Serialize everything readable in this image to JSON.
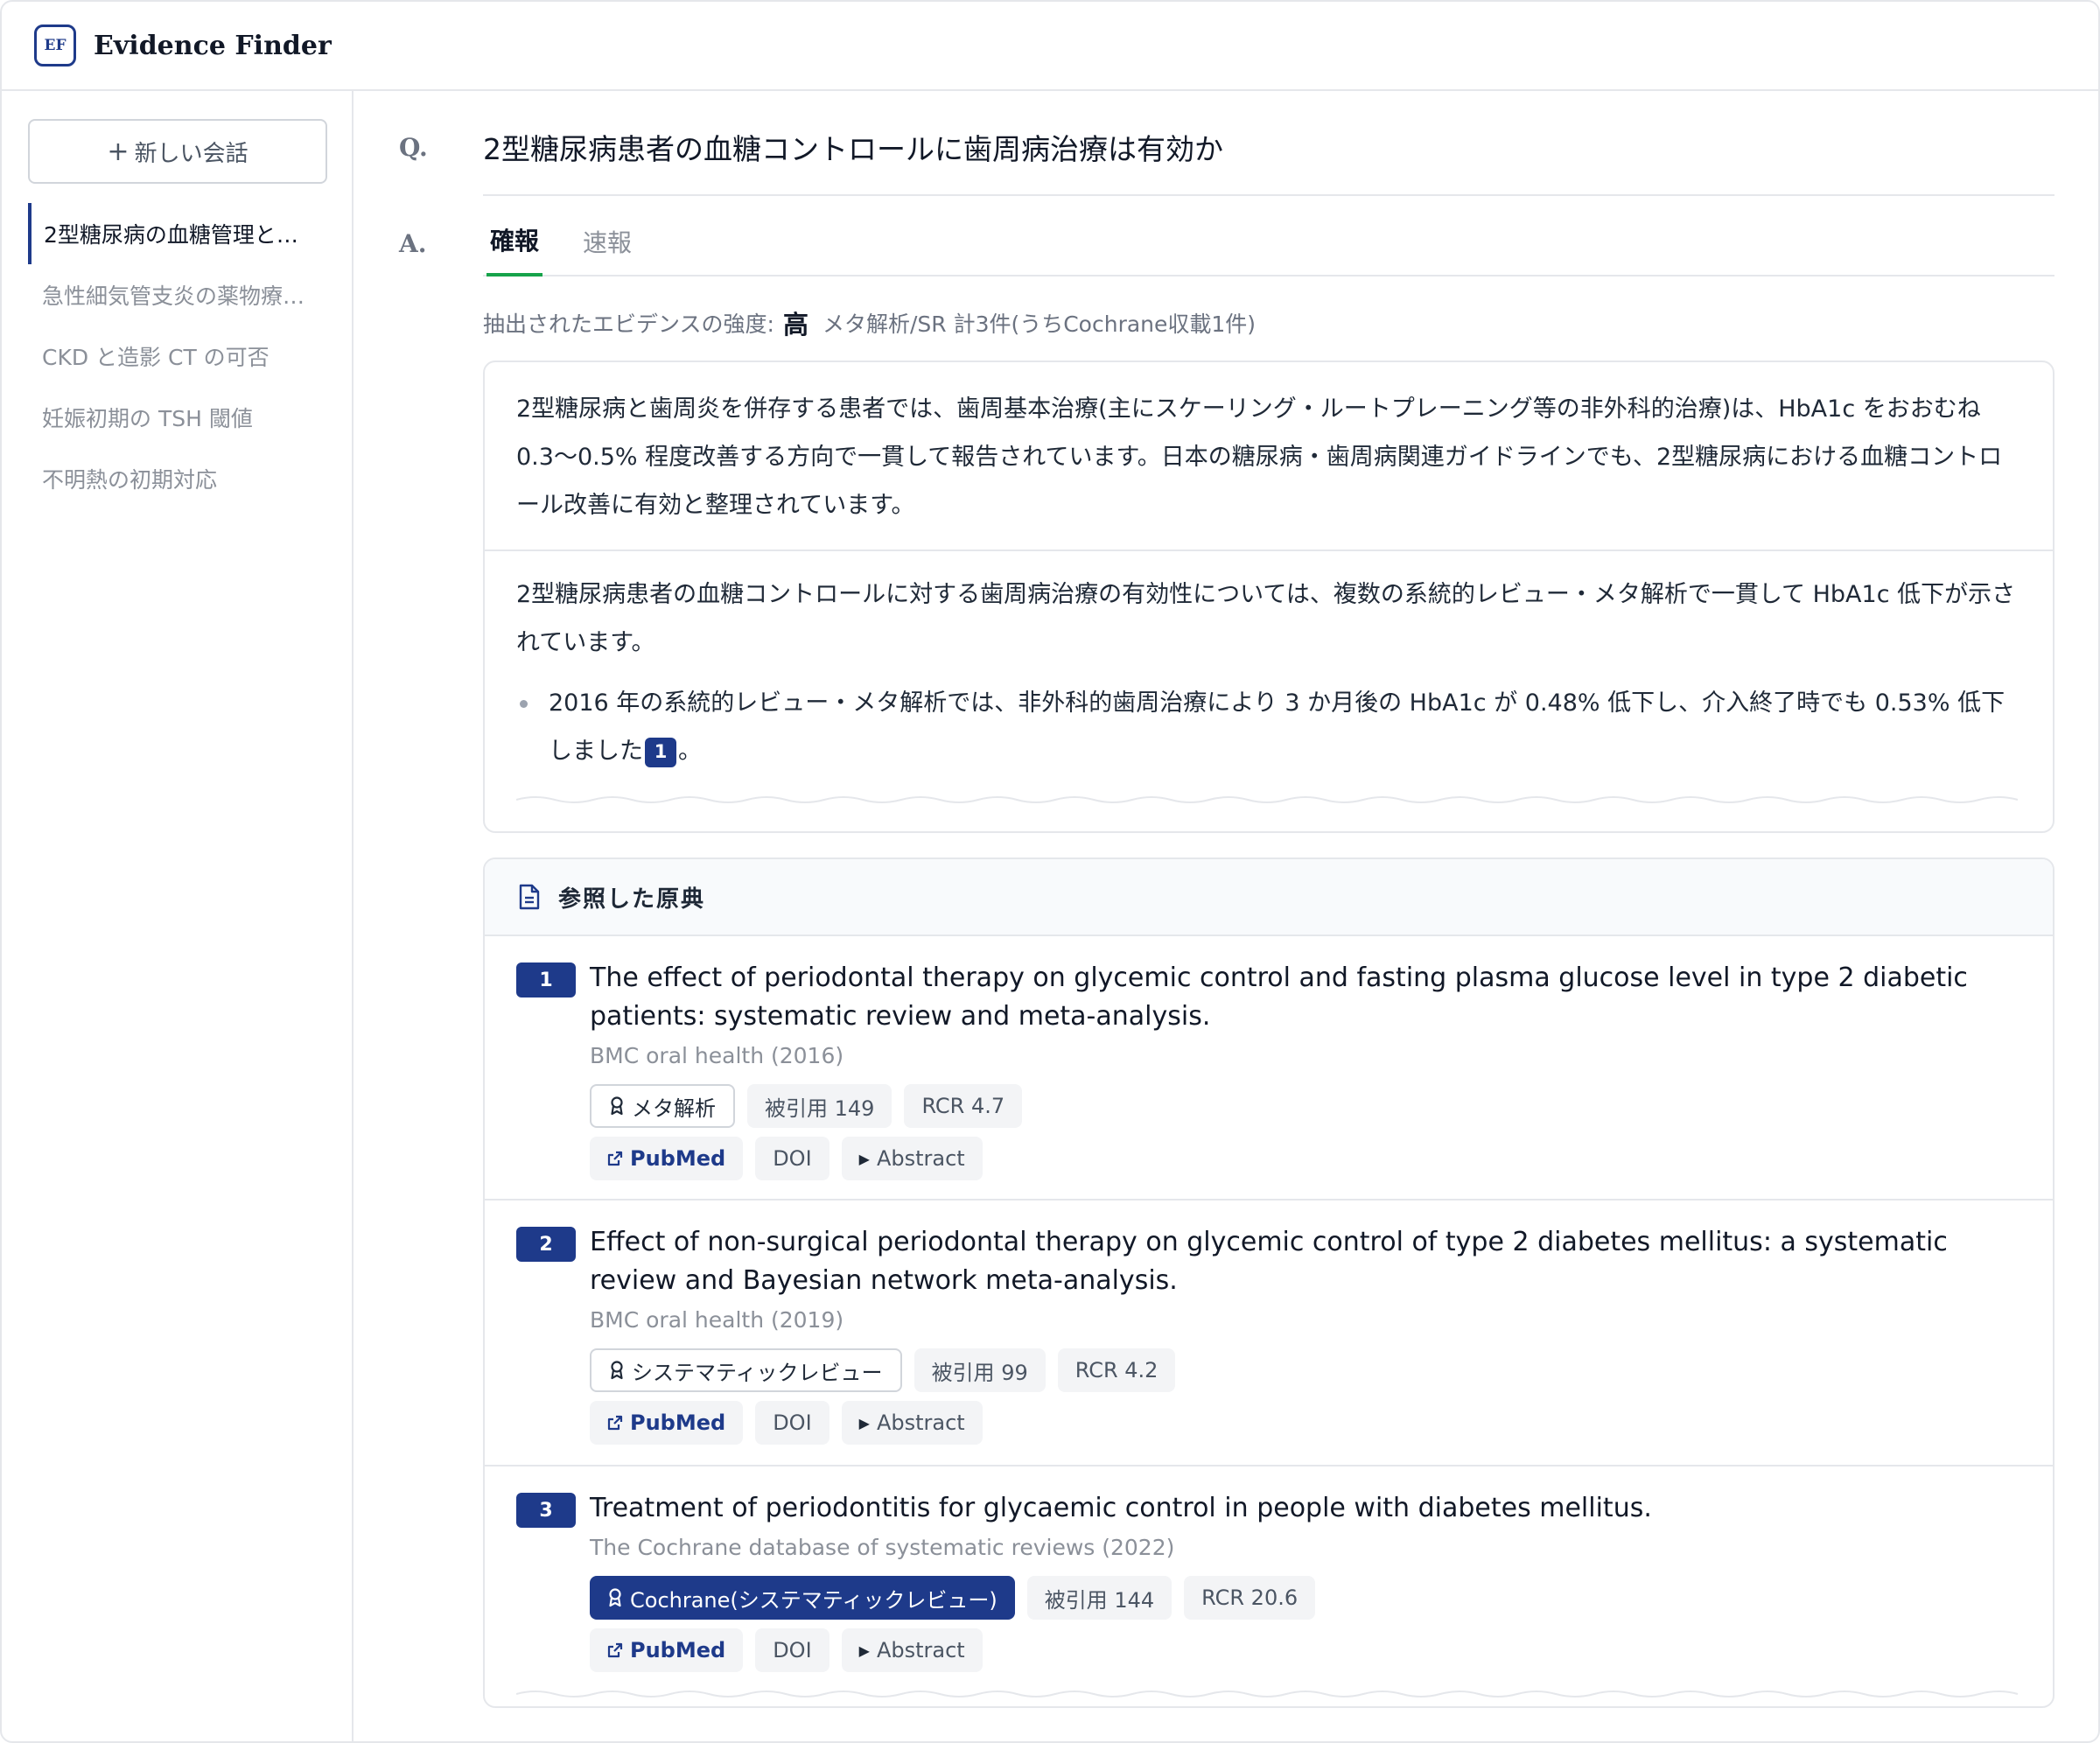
{
  "app": {
    "logo": "EF",
    "title": "Evidence Finder"
  },
  "sidebar": {
    "new_chat": "新しい会話",
    "items": [
      {
        "label": "2型糖尿病の血糖管理と…"
      },
      {
        "label": "急性細気管支炎の薬物療…"
      },
      {
        "label": "CKD と造影 CT の可否"
      },
      {
        "label": "妊娠初期の TSH 閾値"
      },
      {
        "label": "不明熱の初期対応"
      }
    ]
  },
  "main": {
    "q_label": "Q.",
    "question": "2型糖尿病患者の血糖コントロールに歯周病治療は有効か",
    "a_label": "A.",
    "tabs": [
      {
        "label": "確報"
      },
      {
        "label": "速報"
      }
    ],
    "strength": {
      "label": "抽出されたエビデンスの強度:",
      "level": "高",
      "detail": "メタ解析/SR 計3件(うちCochrane収載1件)"
    },
    "summary": "2型糖尿病と歯周炎を併存する患者では、歯周基本治療(主にスケーリング・ルートプレーニング等の非外科的治療)は、HbA1c をおおむね 0.3〜0.5% 程度改善する方向で一貫して報告されています。日本の糖尿病・歯周病関連ガイドラインでも、2型糖尿病における血糖コントロール改善に有効と整理されています。",
    "detail_intro": "2型糖尿病患者の血糖コントロールに対する歯周病治療の有効性については、複数の系統的レビュー・メタ解析で一貫して HbA1c 低下が示されています。",
    "bullet": {
      "text": "2016 年の系統的レビュー・メタ解析では、非外科的歯周治療により 3 か月後の HbA1c が 0.48% 低下し、介入終了時でも 0.53% 低下しました",
      "cite": "1",
      "end": "。"
    }
  },
  "sources": {
    "title": "参照した原典",
    "refs": [
      {
        "num": "1",
        "title": "The effect of periodontal therapy on glycemic control and fasting plasma glucose level in type 2 diabetic patients: systematic review and meta-analysis.",
        "journal": "BMC oral health (2016)",
        "type": "メタ解析",
        "citations": "被引用 149",
        "rcr": "RCR 4.7",
        "pubmed": "PubMed",
        "doi": "DOI",
        "abstract": "Abstract"
      },
      {
        "num": "2",
        "title": "Effect of non-surgical periodontal therapy on glycemic control of type 2 diabetes mellitus: a systematic review and Bayesian network meta-analysis.",
        "journal": "BMC oral health (2019)",
        "type": "システマティックレビュー",
        "citations": "被引用 99",
        "rcr": "RCR 4.2",
        "pubmed": "PubMed",
        "doi": "DOI",
        "abstract": "Abstract"
      },
      {
        "num": "3",
        "title": "Treatment of periodontitis for glycaemic control in people with diabetes mellitus.",
        "journal": "The Cochrane database of systematic reviews (2022)",
        "type": "Cochrane(システマティックレビュー)",
        "citations": "被引用 144",
        "rcr": "RCR 20.6",
        "pubmed": "PubMed",
        "doi": "DOI",
        "abstract": "Abstract"
      }
    ]
  },
  "colors": {
    "accent": "#1e3a8a",
    "tab_active": "#16a34a"
  }
}
